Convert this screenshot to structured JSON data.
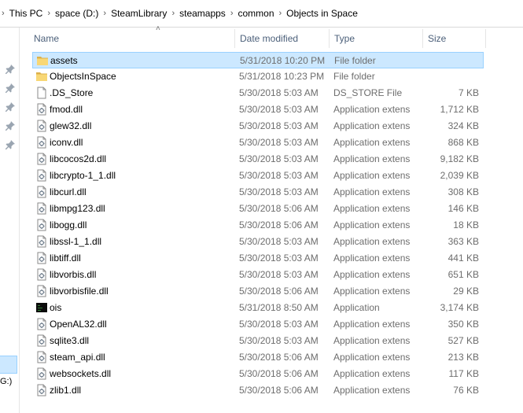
{
  "breadcrumb": [
    "This PC",
    "space (D:)",
    "SteamLibrary",
    "steamapps",
    "common",
    "Objects in Space"
  ],
  "nav": {
    "partial_label": "G:)"
  },
  "columns": {
    "name": "Name",
    "date": "Date modified",
    "type": "Type",
    "size": "Size"
  },
  "files": [
    {
      "name": "assets",
      "date": "5/31/2018 10:20 PM",
      "type": "File folder",
      "size": "",
      "icon": "folder-icon",
      "selected": true
    },
    {
      "name": "ObjectsInSpace",
      "date": "5/31/2018 10:23 PM",
      "type": "File folder",
      "size": "",
      "icon": "folder-icon"
    },
    {
      "name": ".DS_Store",
      "date": "5/30/2018 5:03 AM",
      "type": "DS_STORE File",
      "size": "7 KB",
      "icon": "file-icon"
    },
    {
      "name": "fmod.dll",
      "date": "5/30/2018 5:03 AM",
      "type": "Application extens",
      "size": "1,712 KB",
      "icon": "dll-icon"
    },
    {
      "name": "glew32.dll",
      "date": "5/30/2018 5:03 AM",
      "type": "Application extens",
      "size": "324 KB",
      "icon": "dll-icon"
    },
    {
      "name": "iconv.dll",
      "date": "5/30/2018 5:03 AM",
      "type": "Application extens",
      "size": "868 KB",
      "icon": "dll-icon"
    },
    {
      "name": "libcocos2d.dll",
      "date": "5/30/2018 5:03 AM",
      "type": "Application extens",
      "size": "9,182 KB",
      "icon": "dll-icon"
    },
    {
      "name": "libcrypto-1_1.dll",
      "date": "5/30/2018 5:03 AM",
      "type": "Application extens",
      "size": "2,039 KB",
      "icon": "dll-icon"
    },
    {
      "name": "libcurl.dll",
      "date": "5/30/2018 5:03 AM",
      "type": "Application extens",
      "size": "308 KB",
      "icon": "dll-icon"
    },
    {
      "name": "libmpg123.dll",
      "date": "5/30/2018 5:06 AM",
      "type": "Application extens",
      "size": "146 KB",
      "icon": "dll-icon"
    },
    {
      "name": "libogg.dll",
      "date": "5/30/2018 5:06 AM",
      "type": "Application extens",
      "size": "18 KB",
      "icon": "dll-icon"
    },
    {
      "name": "libssl-1_1.dll",
      "date": "5/30/2018 5:03 AM",
      "type": "Application extens",
      "size": "363 KB",
      "icon": "dll-icon"
    },
    {
      "name": "libtiff.dll",
      "date": "5/30/2018 5:03 AM",
      "type": "Application extens",
      "size": "441 KB",
      "icon": "dll-icon"
    },
    {
      "name": "libvorbis.dll",
      "date": "5/30/2018 5:03 AM",
      "type": "Application extens",
      "size": "651 KB",
      "icon": "dll-icon"
    },
    {
      "name": "libvorbisfile.dll",
      "date": "5/30/2018 5:06 AM",
      "type": "Application extens",
      "size": "29 KB",
      "icon": "dll-icon"
    },
    {
      "name": "ois",
      "date": "5/31/2018 8:50 AM",
      "type": "Application",
      "size": "3,174 KB",
      "icon": "application-icon"
    },
    {
      "name": "OpenAL32.dll",
      "date": "5/30/2018 5:03 AM",
      "type": "Application extens",
      "size": "350 KB",
      "icon": "dll-icon"
    },
    {
      "name": "sqlite3.dll",
      "date": "5/30/2018 5:03 AM",
      "type": "Application extens",
      "size": "527 KB",
      "icon": "dll-icon"
    },
    {
      "name": "steam_api.dll",
      "date": "5/30/2018 5:06 AM",
      "type": "Application extens",
      "size": "213 KB",
      "icon": "dll-icon"
    },
    {
      "name": "websockets.dll",
      "date": "5/30/2018 5:06 AM",
      "type": "Application extens",
      "size": "117 KB",
      "icon": "dll-icon"
    },
    {
      "name": "zlib1.dll",
      "date": "5/30/2018 5:06 AM",
      "type": "Application extens",
      "size": "76 KB",
      "icon": "dll-icon"
    }
  ],
  "colors": {
    "selection": "#cce8ff",
    "selection_border": "#99d1ff",
    "header_text": "#4c607a",
    "folder": "#f8d775"
  }
}
